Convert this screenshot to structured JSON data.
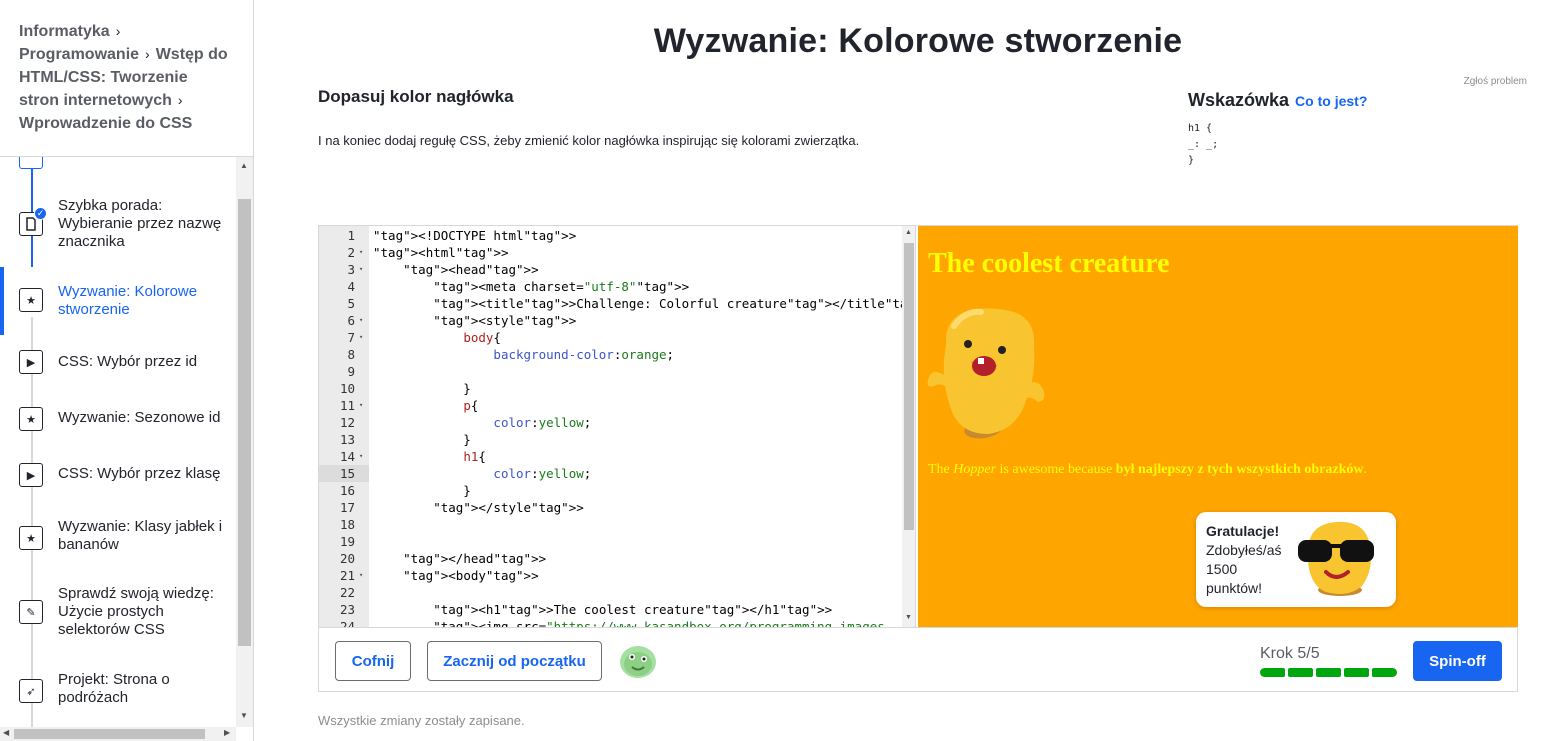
{
  "breadcrumb": [
    {
      "label": "Informatyka"
    },
    {
      "label": "Programowanie"
    },
    {
      "label": "Wstęp do HTML/CSS: Tworzenie stron internetowych"
    },
    {
      "label": "Wprowadzenie do CSS"
    }
  ],
  "sidebar": {
    "items": [
      {
        "label": "Szybka porada: Wybieranie przez nazwę znacznika",
        "icon": "article-icon",
        "completed": true,
        "active": false
      },
      {
        "label": "Wyzwanie: Kolorowe stworzenie",
        "icon": "star-icon",
        "completed": false,
        "active": true
      },
      {
        "label": "CSS: Wybór przez id",
        "icon": "play-icon",
        "completed": false,
        "active": false
      },
      {
        "label": "Wyzwanie: Sezonowe id",
        "icon": "star-icon",
        "completed": false,
        "active": false
      },
      {
        "label": "CSS: Wybór przez klasę",
        "icon": "play-icon",
        "completed": false,
        "active": false
      },
      {
        "label": "Wyzwanie: Klasy jabłek i bananów",
        "icon": "star-icon",
        "completed": false,
        "active": false
      },
      {
        "label": "Sprawdź swoją wiedzę: Użycie prostych selektorów CSS",
        "icon": "pencil-icon",
        "completed": false,
        "active": false
      },
      {
        "label": "Projekt: Strona o podróżach",
        "icon": "rocket-icon",
        "completed": false,
        "active": false
      }
    ]
  },
  "page": {
    "title": "Wyzwanie: Kolorowe stworzenie",
    "report_link": "Zgłoś problem",
    "task_title": "Dopasuj kolor nagłówka",
    "task_desc": "I na koniec dodaj regułę CSS, żeby zmienić kolor nagłówka inspirując się kolorami zwierzątka.",
    "hint_title": "Wskazówka",
    "hint_link": "Co to jest?",
    "hint_code": "h1 {\n_: _;\n}"
  },
  "editor": {
    "lines": [
      "<!DOCTYPE html>",
      "<html>",
      "    <head>",
      "        <meta charset=\"utf-8\">",
      "        <title>Challenge: Colorful creature</title>",
      "        <style>",
      "            body{",
      "                background-color:orange;",
      "",
      "            }",
      "            p{",
      "                color:yellow;",
      "            }",
      "            h1{",
      "                color:yellow;",
      "            }",
      "        </style>",
      "",
      "",
      "    </head>",
      "    <body>",
      "",
      "        <h1>The coolest creature</h1>",
      "        <img src=\"https://www.kasandbox.org/programming-images"
    ],
    "current_line": 15
  },
  "preview": {
    "heading": "The coolest creature",
    "para_before": "The ",
    "para_em": "Hopper",
    "para_after": " is awesome because ",
    "para_strong": "był najlepszy z tych wszystkich obrazków",
    "para_end": ".",
    "bg_color": "#ffa500",
    "text_color": "#ffff00"
  },
  "toast": {
    "title": "Gratulacje!",
    "body": "Zdobyłeś/aś 1500 punktów!"
  },
  "toolbar": {
    "undo_label": "Cofnij",
    "restart_label": "Zacznij od początku",
    "step_label": "Krok 5/5",
    "steps_total": 5,
    "steps_done": 5,
    "spinoff_label": "Spin-off"
  },
  "status": {
    "saved": "Wszystkie zmiany zostały zapisane."
  },
  "colors": {
    "accent": "#1865f2",
    "progress": "#00a60e"
  }
}
